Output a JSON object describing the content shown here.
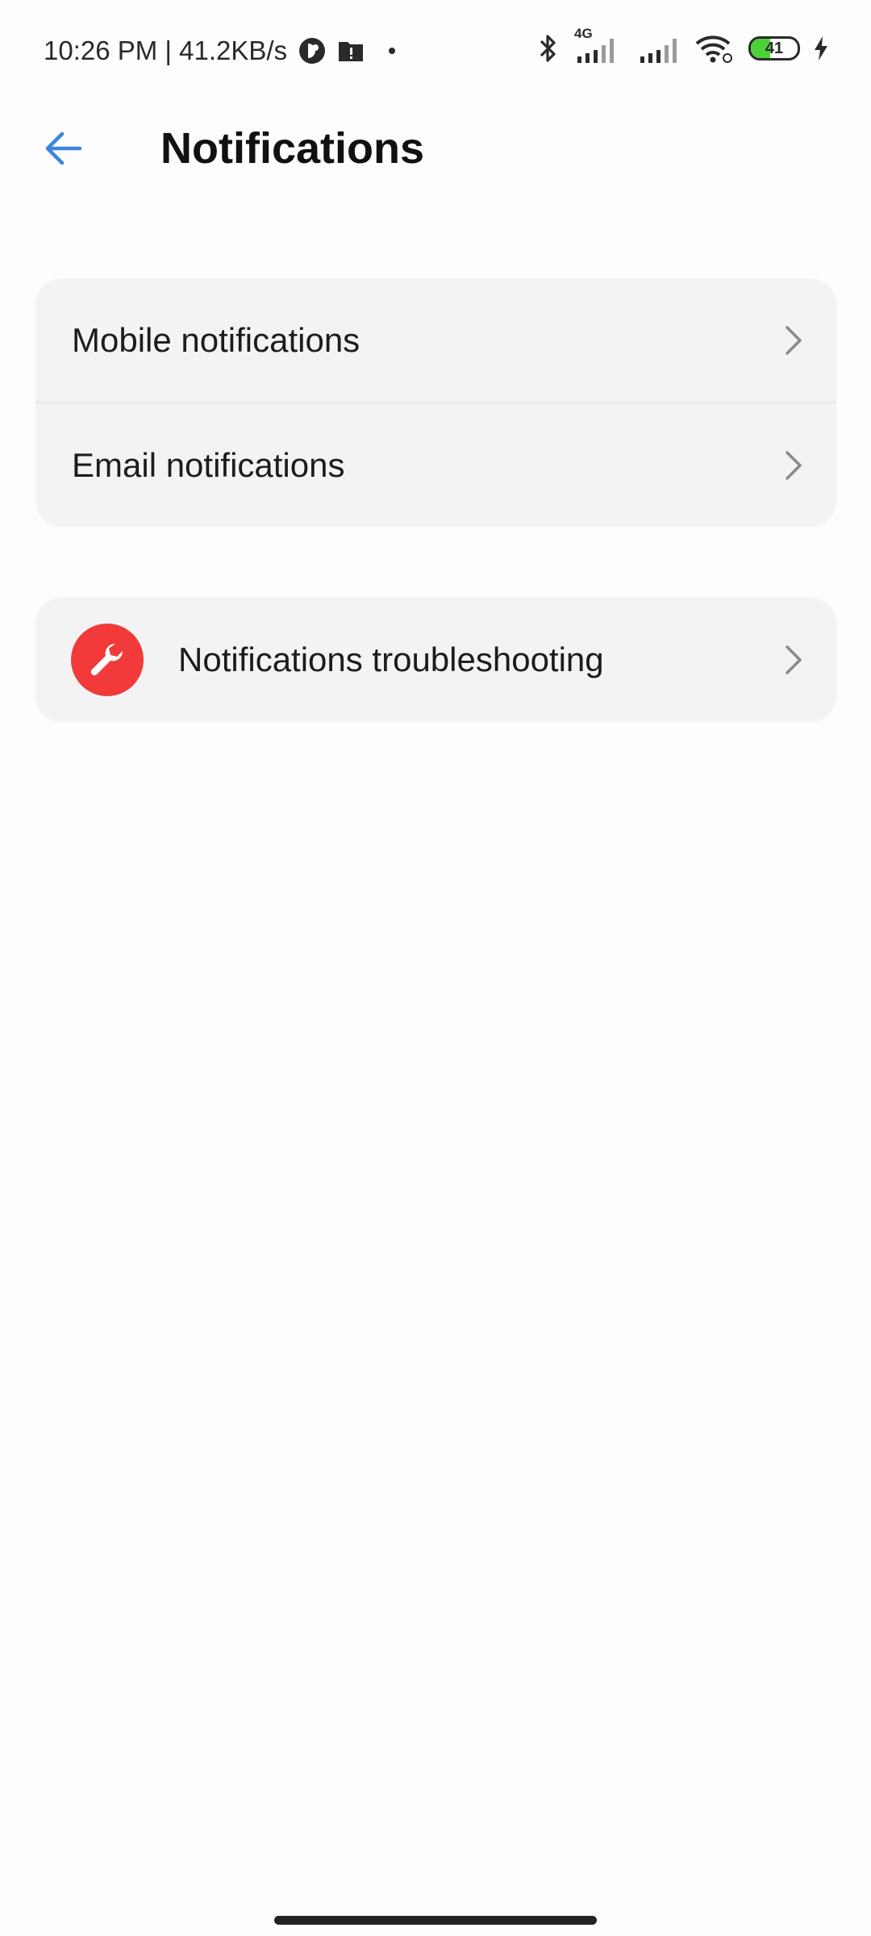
{
  "status_bar": {
    "time_speed": "10:26 PM | 41.2KB/s",
    "network_type": "4G",
    "battery_level": "41",
    "battery_fraction": 0.41,
    "battery_color": "#4cd137",
    "icons": [
      "app-notification-icon",
      "warning-folder-icon",
      "dot-icon",
      "bluetooth-icon",
      "signal-icon",
      "wifi-icon",
      "battery-icon",
      "charging-icon"
    ]
  },
  "header": {
    "title": "Notifications",
    "back_icon": "back-arrow-icon",
    "accent_color": "#3a86e0"
  },
  "settings_group": {
    "items": [
      {
        "label": "Mobile notifications",
        "icon": "chevron-right-icon"
      },
      {
        "label": "Email notifications",
        "icon": "chevron-right-icon"
      }
    ]
  },
  "troubleshooting": {
    "label": "Notifications troubleshooting",
    "icon": "wrench-icon",
    "icon_color": "#f23a3a"
  }
}
